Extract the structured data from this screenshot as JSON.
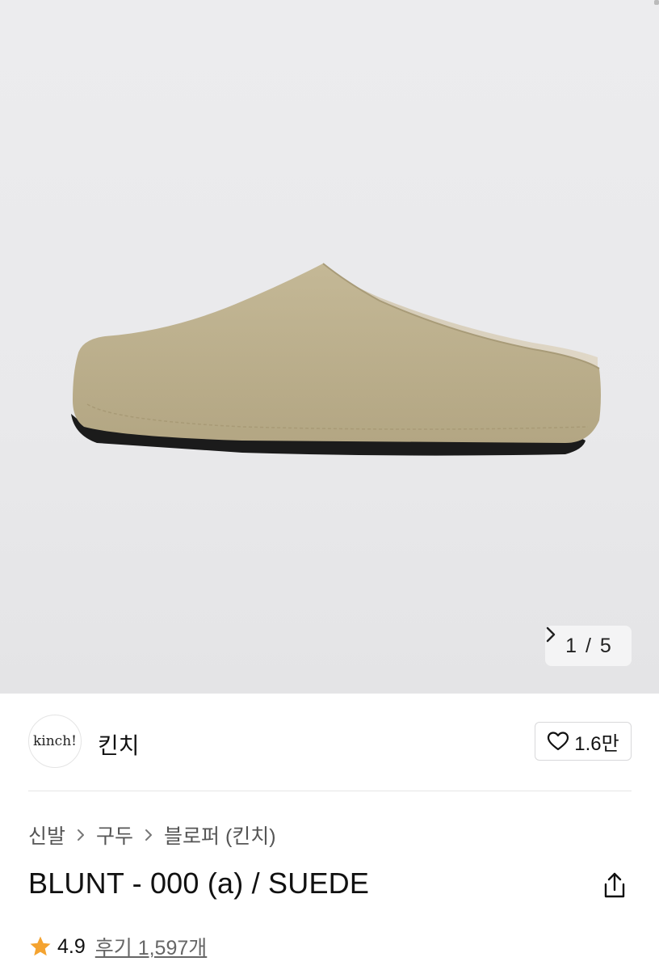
{
  "gallery": {
    "image_alt": "beige suede slipper",
    "current_page": "1",
    "separator": "/",
    "total_pages": "5",
    "next_icon": "chevron-right-icon"
  },
  "brand": {
    "logo_text": "kinch!",
    "name": "킨치",
    "like_count": "1.6만",
    "like_icon": "heart-outline-icon"
  },
  "breadcrumb": {
    "items": [
      "신발",
      "구두",
      "블로퍼 (킨치)"
    ],
    "separator_icon": "chevron-right-icon"
  },
  "product": {
    "title": "BLUNT - 000 (a) / SUEDE",
    "share_icon": "share-icon"
  },
  "rating": {
    "score": "4.9",
    "reviews_label": "후기 1,597개",
    "star_color": "#f4a330"
  }
}
